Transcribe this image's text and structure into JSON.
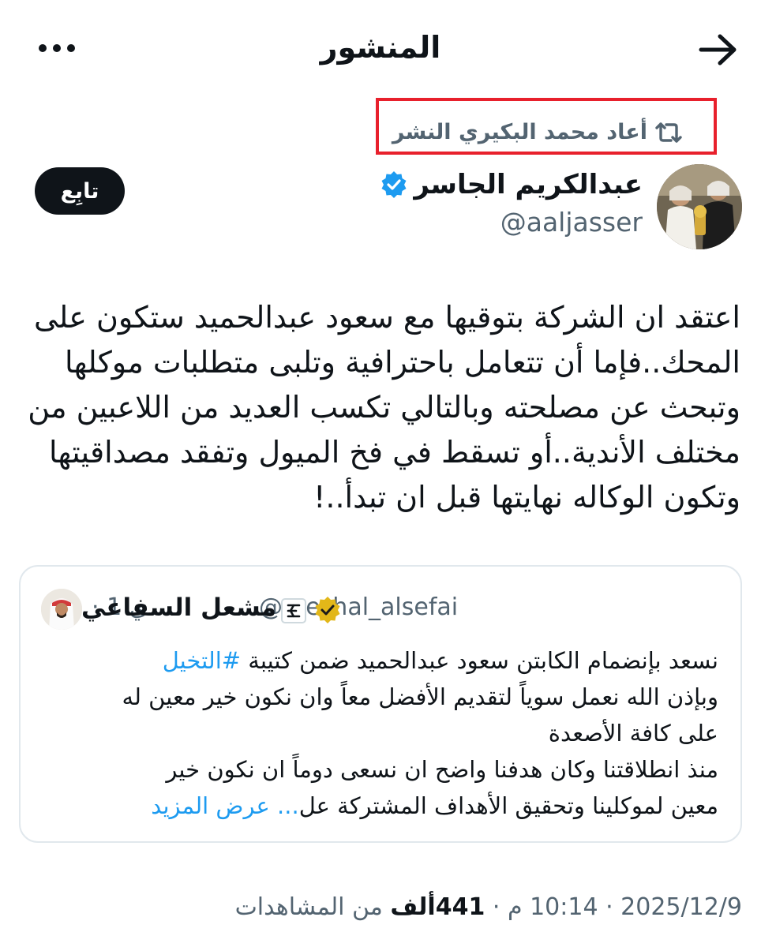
{
  "header": {
    "title": "المنشور",
    "back_icon": "arrow-right-icon",
    "more_icon": "more-dots-icon"
  },
  "repost": {
    "text": "أعاد محمد البكيري النشر",
    "icon": "repost-icon",
    "highlight_color": "#e8202c"
  },
  "author": {
    "name": "عبدالكريم الجاسر",
    "handle": "@aaljasser",
    "verified": true,
    "follow_label": "تابِع"
  },
  "tweet": {
    "lines": [
      "اعتقد ان الشركة بتوقيها مع سعود عبدالحميد ستكون على",
      "المحك..فإما أن تتعامل باحترافية وتلبى متطلبات موكلها",
      "وتبحث عن مصلحته وبالتالي تكسب العديد من اللاعبين من",
      "مختلف الأندية..أو تسقط في فخ الميول وتفقد مصداقيتها",
      "وتكون الوكاله نهايتها قبل ان تبدأ..!"
    ]
  },
  "quote": {
    "name": "مشعل السفاعي",
    "handle": "@meshal_alsefai",
    "time": "· 1 ي",
    "line1_text": "نسعد بإنضمام الكابتن سعود عبدالحميد ضمن كتيبة ",
    "line1_hashtag": "#التخيل",
    "lines": [
      "وبإذن الله نعمل سوياً لتقديم الأفضل معاً وان نكون خير معين له",
      "على كافة الأصعدة",
      "منذ انطلاقتنا وكان هدفنا واضح ان نسعى دوماً ان نكون خير"
    ],
    "last_line_text": "معين لموكلينا وتحقيق الأهداف المشتركة عل",
    "show_more": "... عرض المزيد"
  },
  "meta": {
    "date": "2025/12/9",
    "time": "10:14 م",
    "views_count": "441ألف",
    "views_label": "من المشاهدات"
  },
  "colors": {
    "link": "#1d9bf0",
    "secondary_text": "#536471",
    "verified_blue": "#1d9bf0",
    "verified_gold": "#e2b719"
  }
}
